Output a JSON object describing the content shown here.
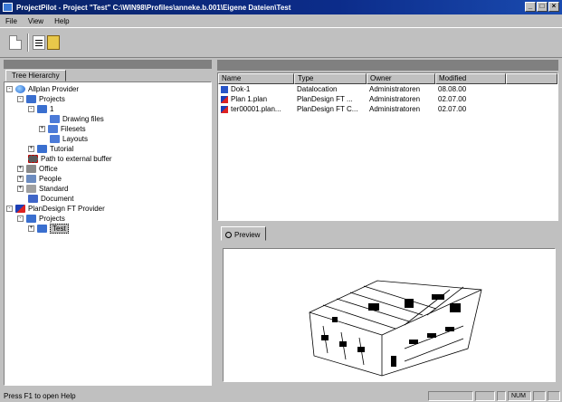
{
  "window": {
    "title": "ProjectPilot - Project \"Test\" C:\\WIN98\\Profiles\\anneke.b.001\\Eigene Dateien\\Test",
    "minimize": "_",
    "maximize": "□",
    "close": "×"
  },
  "menu": {
    "items": [
      "File",
      "View",
      "Help"
    ]
  },
  "left": {
    "tab": "Tree Hierarchy",
    "tree": [
      {
        "label": "Allplan Provider",
        "icon": "globe-icon",
        "exp": "-"
      },
      {
        "label": "Projects",
        "icon": "projects-folder-icon",
        "exp": "-"
      },
      {
        "label": "1",
        "icon": "project-icon",
        "exp": "-"
      },
      {
        "label": "Drawing files",
        "icon": "drawing-files-icon",
        "exp": ""
      },
      {
        "label": "Filesets",
        "icon": "filesets-icon",
        "exp": "+"
      },
      {
        "label": "Layouts",
        "icon": "layouts-icon",
        "exp": ""
      },
      {
        "label": "Tutorial",
        "icon": "project-icon",
        "exp": "+"
      },
      {
        "label": "Path to external buffer",
        "icon": "link-icon",
        "exp": ""
      },
      {
        "label": "Office",
        "icon": "office-icon",
        "exp": "+"
      },
      {
        "label": "People",
        "icon": "people-icon",
        "exp": "+"
      },
      {
        "label": "Standard",
        "icon": "standard-icon",
        "exp": "+"
      },
      {
        "label": "Document",
        "icon": "document-icon",
        "exp": ""
      },
      {
        "label": "PlanDesign FT Provider",
        "icon": "plandesign-provider-icon",
        "exp": "-"
      },
      {
        "label": "Projects",
        "icon": "projects-folder-icon",
        "exp": "-"
      },
      {
        "label": "Test",
        "icon": "project-icon",
        "exp": "+"
      }
    ]
  },
  "list": {
    "columns": [
      "Name",
      "Type",
      "Owner",
      "Modified"
    ],
    "rows": [
      {
        "name": "Dok-1",
        "type": "Datalocation",
        "owner": "Administratoren",
        "modified": "08.08.00"
      },
      {
        "name": "Plan 1.plan",
        "type": "PlanDesign FT ...",
        "owner": "Administratoren",
        "modified": "02.07.00"
      },
      {
        "name": "ter00001.plan...",
        "type": "PlanDesign FT C...",
        "owner": "Administratoren",
        "modified": "02.07.00"
      }
    ]
  },
  "preview": {
    "tab": "Preview"
  },
  "status": {
    "text": "Press F1 to open Help",
    "cells": [
      "",
      "",
      "",
      "NUM",
      "",
      ""
    ]
  },
  "colors": {
    "title_bar": "#0a2468",
    "window_bg": "#c0c0c0"
  }
}
